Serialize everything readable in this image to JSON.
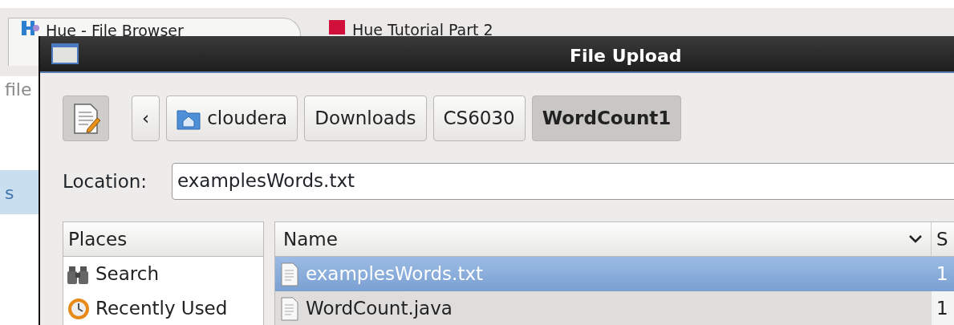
{
  "browser": {
    "tabs": [
      {
        "label": "Hue - File Browser",
        "selected": true
      },
      {
        "label": "Hue Tutorial Part 2",
        "selected": false
      }
    ],
    "address": "file",
    "sidebar_fragment": "s"
  },
  "dialog": {
    "title": "File Upload",
    "back": "‹",
    "path": [
      {
        "label": "cloudera",
        "kind": "home",
        "selected": false
      },
      {
        "label": "Downloads",
        "kind": "folder",
        "selected": false
      },
      {
        "label": "CS6030",
        "kind": "folder",
        "selected": false
      },
      {
        "label": "WordCount1",
        "kind": "folder",
        "selected": true
      }
    ],
    "location_label": "Location:",
    "location_value": "examplesWords.txt",
    "places_header": "Places",
    "places": [
      {
        "label": "Search",
        "kind": "search"
      },
      {
        "label": "Recently Used",
        "kind": "recent"
      }
    ],
    "columns": [
      "Name",
      "S"
    ],
    "files": [
      {
        "name": "examplesWords.txt",
        "size": "1",
        "selected": true
      },
      {
        "name": "WordCount.java",
        "size": "1",
        "selected": false
      }
    ]
  }
}
